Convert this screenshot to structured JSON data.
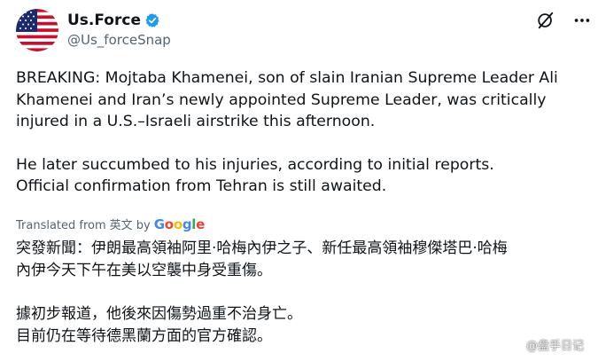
{
  "tweet": {
    "display_name": "Us.Force",
    "handle": "@Us_forceSnap",
    "body_en": [
      "BREAKING: Mojtaba Khamenei, son of slain Iranian Supreme Leader Ali\nKhamenei and Iran’s newly appointed Supreme Leader, was critically\ninjured in a U.S.–Israeli airstrike this afternoon.",
      "He later succumbed to his injuries, according to initial reports.\nOfficial confirmation from Tehran is still awaited."
    ],
    "translation": {
      "translated_from": "Translated from",
      "source_lang": "英文",
      "by": "by",
      "provider": "Google"
    },
    "body_zh": [
      "突發新聞：伊朗最高領袖阿里·哈梅內伊之子、新任最高領袖穆傑塔巴·哈梅\n內伊今天下午在美以空襲中身受重傷。",
      "據初步報道，他後來因傷勢過重不治身亡。\n目前仍在等待德黑蘭方面的官方確認。"
    ]
  },
  "watermark": "@盘手日记",
  "icons": {
    "verified": "verified-badge-icon",
    "grok": "grok-icon",
    "more": "more-options-icon",
    "weibo": "weibo-icon"
  },
  "colors": {
    "verified_blue": "#1d9bf0",
    "text": "#0f1419",
    "muted": "#536471"
  }
}
